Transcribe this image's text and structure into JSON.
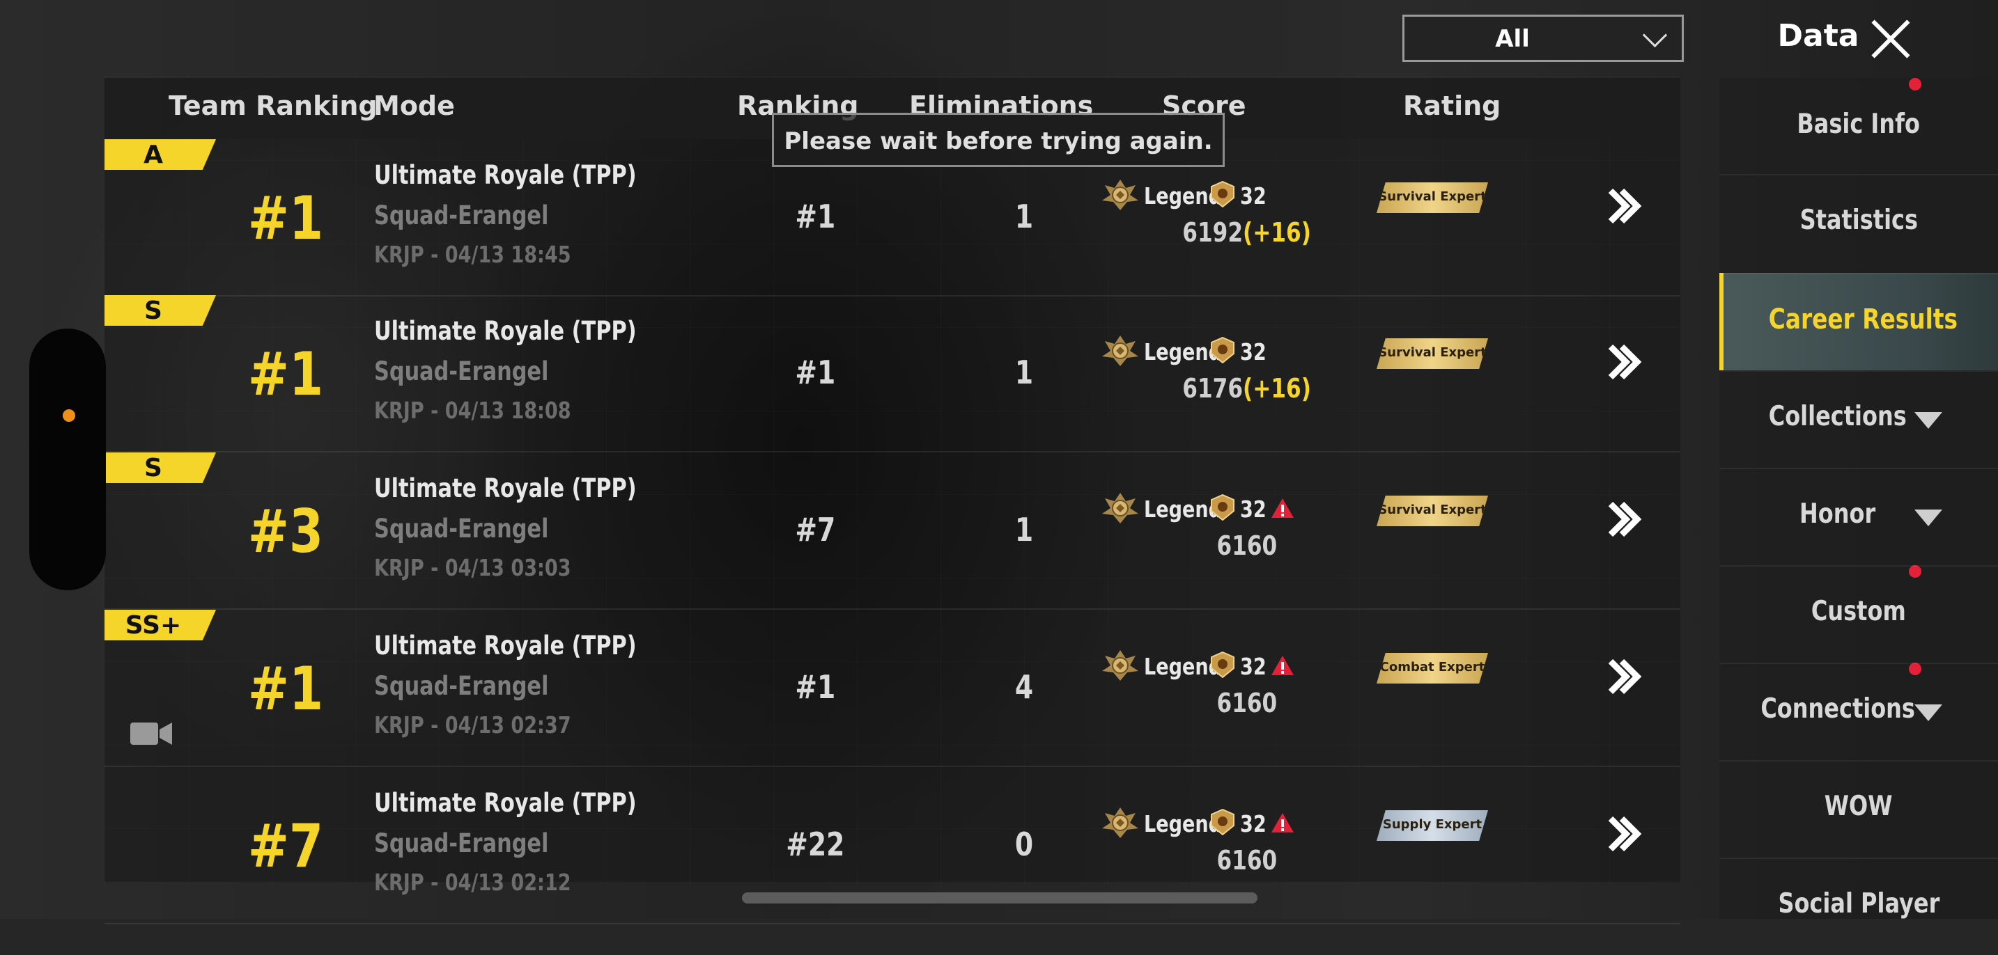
{
  "header": {
    "filter_value": "All",
    "title": "Data"
  },
  "columns": {
    "team_ranking": "Team Ranking",
    "mode": "Mode",
    "ranking": "Ranking",
    "eliminations": "Eliminations",
    "score": "Score",
    "rating": "Rating"
  },
  "toast": "Please wait before trying again.",
  "matches": [
    {
      "grade": "A",
      "team_rank": "#1",
      "mode": "Ultimate Royale (TPP)",
      "map": "Squad-Erangel",
      "time": "KRJP - 04/13 18:45",
      "ranking": "#1",
      "eliminations": "1",
      "tier": "Legend",
      "tier_level": "32",
      "score": "6192",
      "delta": "(+16)",
      "rating": "Survival Expert",
      "rating_color": "gold",
      "warning": false,
      "video": false
    },
    {
      "grade": "S",
      "team_rank": "#1",
      "mode": "Ultimate Royale (TPP)",
      "map": "Squad-Erangel",
      "time": "KRJP - 04/13 18:08",
      "ranking": "#1",
      "eliminations": "1",
      "tier": "Legend",
      "tier_level": "32",
      "score": "6176",
      "delta": "(+16)",
      "rating": "Survival Expert",
      "rating_color": "gold",
      "warning": false,
      "video": false
    },
    {
      "grade": "S",
      "team_rank": "#3",
      "mode": "Ultimate Royale (TPP)",
      "map": "Squad-Erangel",
      "time": "KRJP - 04/13 03:03",
      "ranking": "#7",
      "eliminations": "1",
      "tier": "Legend",
      "tier_level": "32",
      "score": "6160",
      "delta": "",
      "rating": "Survival Expert",
      "rating_color": "gold",
      "warning": true,
      "video": false
    },
    {
      "grade": "SS+",
      "team_rank": "#1",
      "mode": "Ultimate Royale (TPP)",
      "map": "Squad-Erangel",
      "time": "KRJP - 04/13 02:37",
      "ranking": "#1",
      "eliminations": "4",
      "tier": "Legend",
      "tier_level": "32",
      "score": "6160",
      "delta": "",
      "rating": "Combat Expert",
      "rating_color": "gold",
      "warning": true,
      "video": true
    },
    {
      "grade": "",
      "team_rank": "#7",
      "mode": "Ultimate Royale (TPP)",
      "map": "Squad-Erangel",
      "time": "KRJP - 04/13 02:12",
      "ranking": "#22",
      "eliminations": "0",
      "tier": "Legend",
      "tier_level": "32",
      "score": "6160",
      "delta": "",
      "rating": "Supply Expert",
      "rating_color": "silver",
      "warning": true,
      "video": false
    }
  ],
  "sidebar": {
    "items": [
      {
        "label": "Basic Info",
        "active": false,
        "caret": false,
        "dot": true
      },
      {
        "label": "Statistics",
        "active": false,
        "caret": false,
        "dot": false
      },
      {
        "label": "Career Results",
        "active": true,
        "caret": false,
        "dot": false
      },
      {
        "label": "Collections",
        "active": false,
        "caret": true,
        "dot": false
      },
      {
        "label": "Honor",
        "active": false,
        "caret": true,
        "dot": false
      },
      {
        "label": "Custom",
        "active": false,
        "caret": false,
        "dot": true
      },
      {
        "label": "Connections",
        "active": false,
        "caret": true,
        "dot": true
      },
      {
        "label": "WOW",
        "active": false,
        "caret": false,
        "dot": false
      },
      {
        "label": "Social Player",
        "active": false,
        "caret": false,
        "dot": false
      }
    ]
  },
  "colors": {
    "accent": "#f5d52a",
    "notification": "#e5213a",
    "handle_dot": "#f09018"
  }
}
